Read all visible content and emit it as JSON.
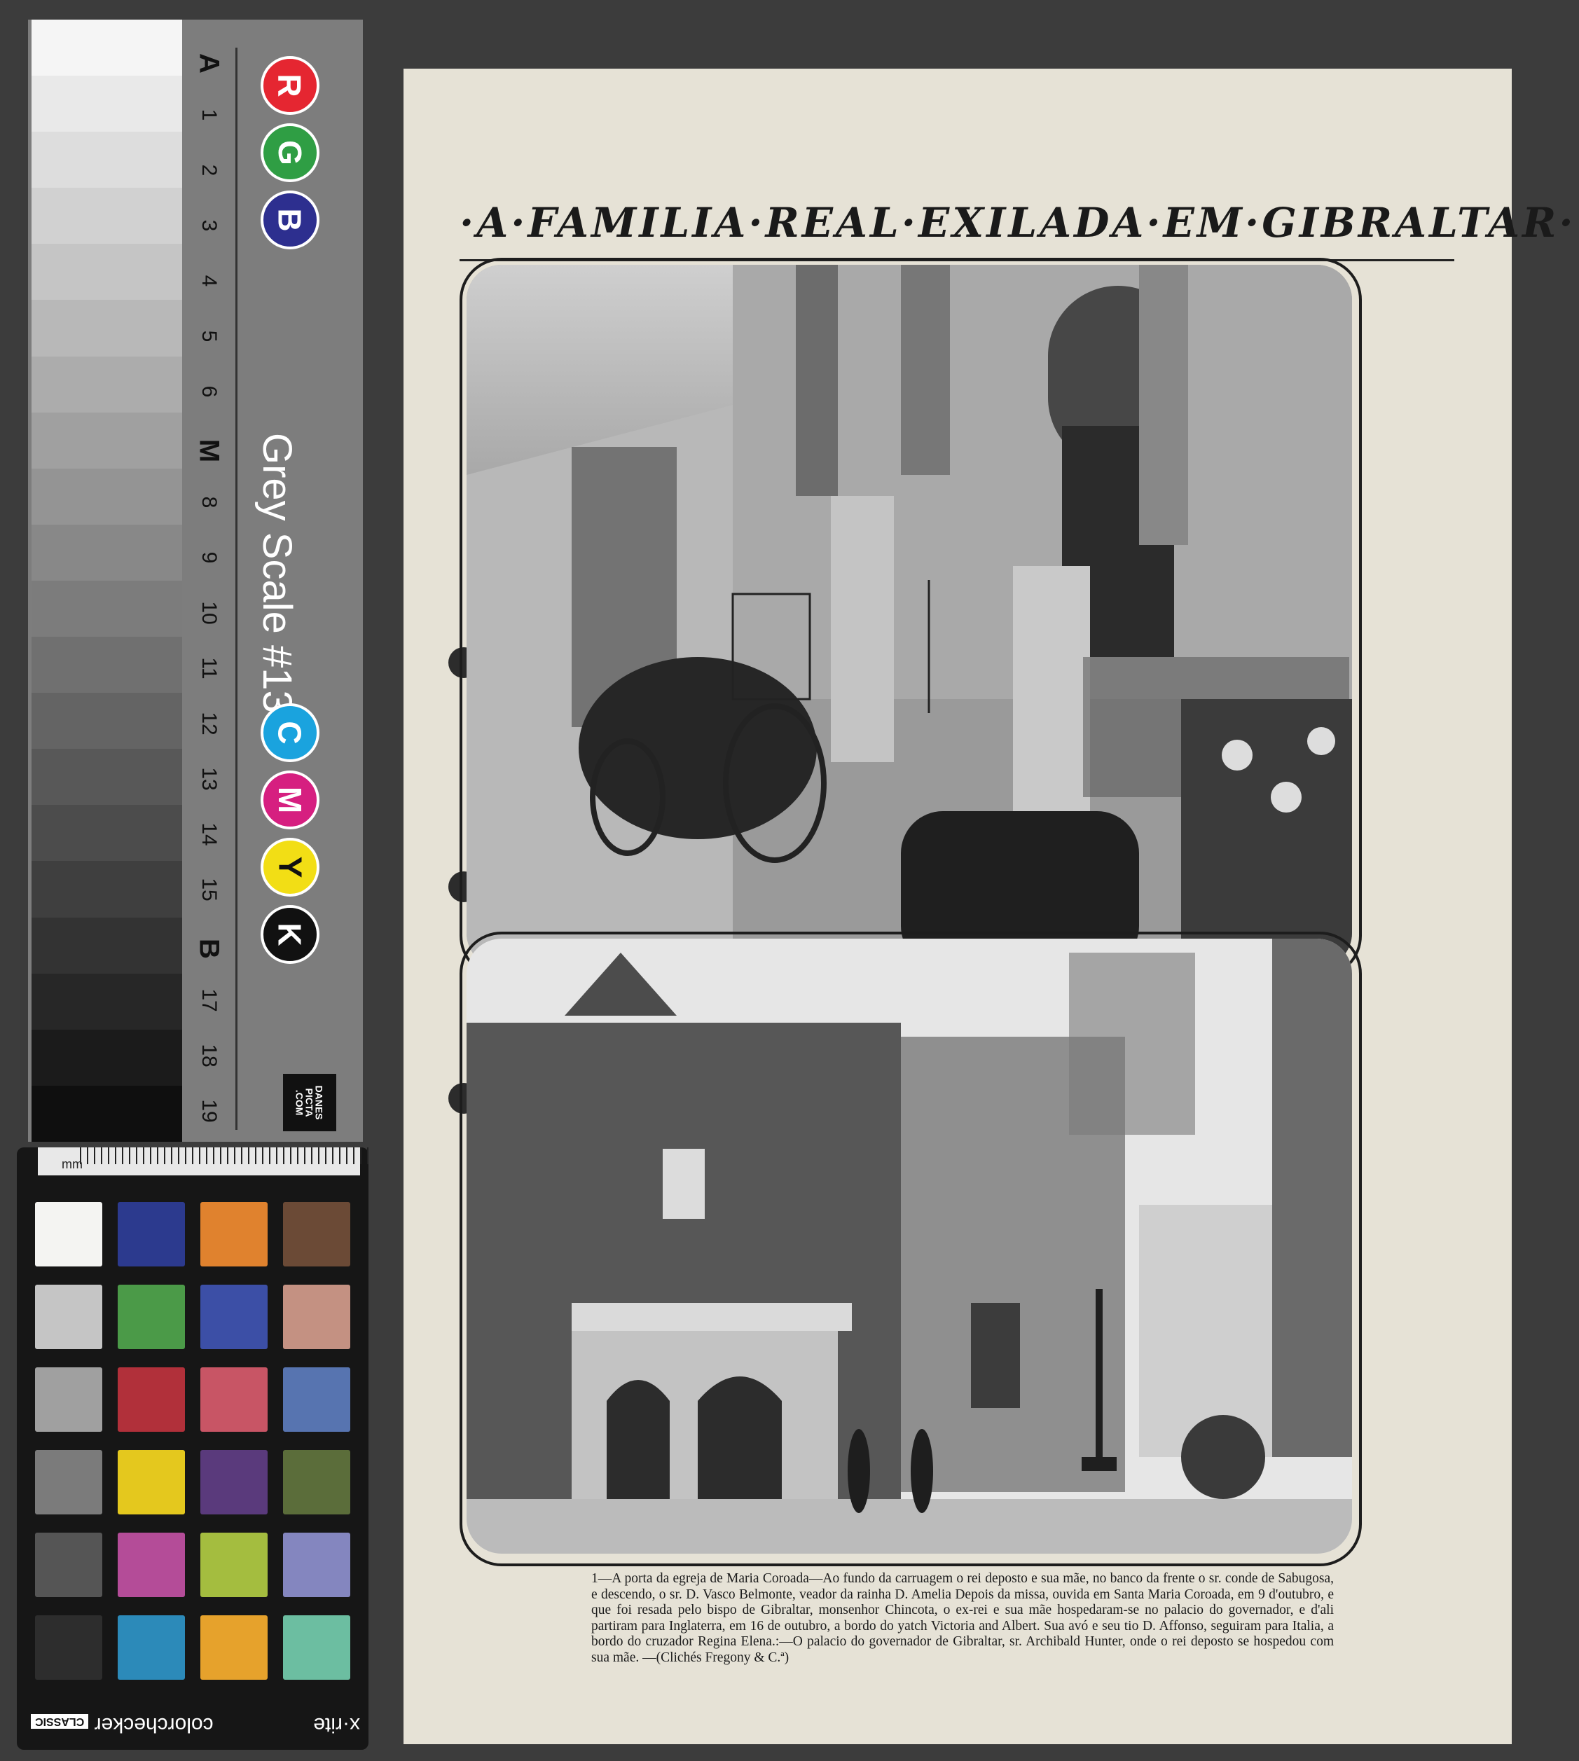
{
  "grey_scale": {
    "title": "Grey Scale #13",
    "labels": [
      "A",
      "1",
      "2",
      "3",
      "4",
      "5",
      "6",
      "M",
      "8",
      "9",
      "10",
      "11",
      "12",
      "13",
      "14",
      "15",
      "B",
      "17",
      "18",
      "19"
    ],
    "rgb": [
      {
        "letter": "R",
        "color": "#e52631"
      },
      {
        "letter": "G",
        "color": "#2f9e44"
      },
      {
        "letter": "B",
        "color": "#2d2f8f"
      }
    ],
    "cmyk": [
      {
        "letter": "C",
        "color": "#1aa3de"
      },
      {
        "letter": "M",
        "color": "#d61f80"
      },
      {
        "letter": "Y",
        "color": "#f2de15"
      },
      {
        "letter": "K",
        "color": "#111111"
      }
    ],
    "brand": "DANES\nPICTA\n.COM"
  },
  "colorchecker": {
    "ruler_unit": "mm",
    "brand": "x·rite",
    "product": "colorchecker",
    "edition": "CLASSIC",
    "patches": [
      "#f4f4f2",
      "#2c3a8e",
      "#e0822e",
      "#6b4a36",
      "#c5c5c5",
      "#4b9a48",
      "#3c4fa6",
      "#c49182",
      "#a0a0a0",
      "#b1303a",
      "#c85565",
      "#5774b0",
      "#7b7b7b",
      "#e4c81e",
      "#5a3a7c",
      "#5b6d3a",
      "#555555",
      "#b44c98",
      "#a4bd3f",
      "#8486bf",
      "#2d2d2d",
      "#2c8ab9",
      "#e6a22c",
      "#6cbea1"
    ]
  },
  "page": {
    "headline": "·A·FAMILIA·REAL·EXILADA·EM·GIBRALTAR·",
    "caption": "1—A porta da egreja de Maria Coroada—Ao fundo da carruagem o rei deposto e sua mãe, no banco da frente o sr. conde de Sabugosa, e descendo, o sr. D. Vasco Belmonte, veador da rainha D. Amelia Depois da missa, ouvida em Santa Maria Coroada, em 9 d'outubro, e que foi resada pelo bispo de Gibraltar, monsenhor Chincota, o ex-rei e sua mãe hospedaram-se no palacio do governador, e d'ali partiram para Inglaterra, em 16 de outubro, a bordo do yatch Victoria and Albert. Sua avó e seu tio D. Affonso, seguiram para Italia, a bordo do cruzador Regina Elena.:—O palacio do governador de Gibraltar, sr. Archibald Hunter, onde o rei deposto se hospedou com sua mãe. —(Clichés Fregony & C.ª)"
  }
}
